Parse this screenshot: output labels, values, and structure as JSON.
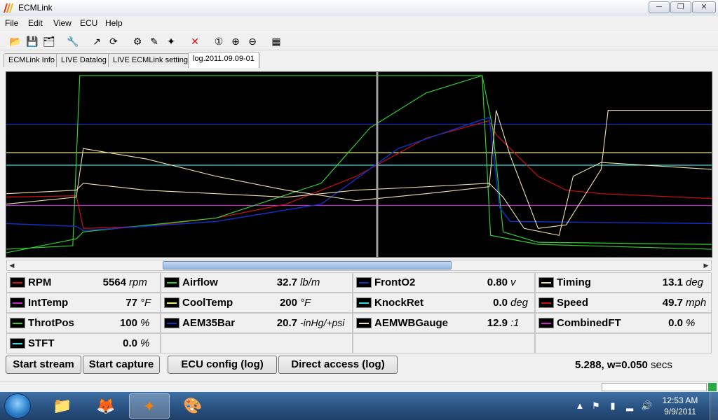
{
  "window": {
    "title": "ECMLink",
    "min_glyph": "─",
    "max_glyph": "❐",
    "close_glyph": "✕"
  },
  "menu": [
    "File",
    "Edit",
    "View",
    "ECU",
    "Help"
  ],
  "toolbar": {
    "icons": [
      "open-folder-icon",
      "save-icon",
      "save-all-icon",
      "tools-icon",
      "export-icon",
      "refresh-icon",
      "settings-icon",
      "map-edit-icon",
      "wand-icon",
      "delete-icon",
      "zoom-reset-icon",
      "zoom-in-icon",
      "zoom-out-icon",
      "grid-icon"
    ],
    "glyphs": [
      "📂",
      "💾",
      "🗂",
      "🔧",
      "↗",
      "⟳",
      "⚙",
      "✎",
      "✦",
      "✕",
      "①",
      "⊕",
      "⊖",
      "▦"
    ]
  },
  "tabs": [
    "ECMLink Info",
    "LIVE Datalog",
    "LIVE ECMLink settings",
    "log.2011.09.09-01"
  ],
  "active_tab": 3,
  "gauges": {
    "col0": [
      {
        "label": "RPM",
        "value": "5564",
        "unit": "rpm",
        "color": "#d01010"
      },
      {
        "label": "IntTemp",
        "value": "77",
        "unit": "°F",
        "color": "#d020d0"
      },
      {
        "label": "ThrotPos",
        "value": "100",
        "unit": "%",
        "color": "#30d030"
      },
      {
        "label": "STFT",
        "value": "0.0",
        "unit": "%",
        "color": "#30e0e0"
      }
    ],
    "col1": [
      {
        "label": "Airflow",
        "value": "32.7",
        "unit": "lb/m",
        "color": "#30d030"
      },
      {
        "label": "CoolTemp",
        "value": "200",
        "unit": "°F",
        "color": "#f0f060"
      },
      {
        "label": "AEM35Bar",
        "value": "20.7",
        "unit": "-inHg/+psi",
        "color": "#1030c0"
      }
    ],
    "col2": [
      {
        "label": "FrontO2",
        "value": "0.80",
        "unit": "v",
        "color": "#1030c0"
      },
      {
        "label": "KnockRet",
        "value": "0.0",
        "unit": "deg",
        "color": "#30e0e0"
      },
      {
        "label": "AEMWBGauge",
        "value": "12.9",
        "unit": ":1",
        "color": "#f0e0b0"
      }
    ],
    "col3": [
      {
        "label": "Timing",
        "value": "13.1",
        "unit": "deg",
        "color": "#f0e0b0"
      },
      {
        "label": "Speed",
        "value": "49.7",
        "unit": "mph",
        "color": "#d01010"
      },
      {
        "label": "CombinedFT",
        "value": "0.0",
        "unit": "%",
        "color": "#d020d0"
      }
    ]
  },
  "buttons": {
    "start_stream": "Start stream",
    "start_capture": "Start capture",
    "ecu_config": "ECU config (log)",
    "direct_access": "Direct access (log)"
  },
  "status": {
    "position": "5.288, w=0.050",
    "unit": "secs"
  },
  "scroll": {
    "left_glyph": "◀",
    "right_glyph": "▶"
  },
  "taskbar": {
    "apps": [
      {
        "name": "explorer-icon",
        "glyph": "📁"
      },
      {
        "name": "firefox-icon",
        "glyph": "🦊"
      },
      {
        "name": "ecmlink-icon",
        "glyph": "✦"
      },
      {
        "name": "paint-icon",
        "glyph": "🎨"
      }
    ],
    "tray_glyphs": [
      "▲",
      "⚑",
      "▮",
      "▂",
      "🔊"
    ],
    "time": "12:53 AM",
    "date": "9/9/2011"
  }
}
